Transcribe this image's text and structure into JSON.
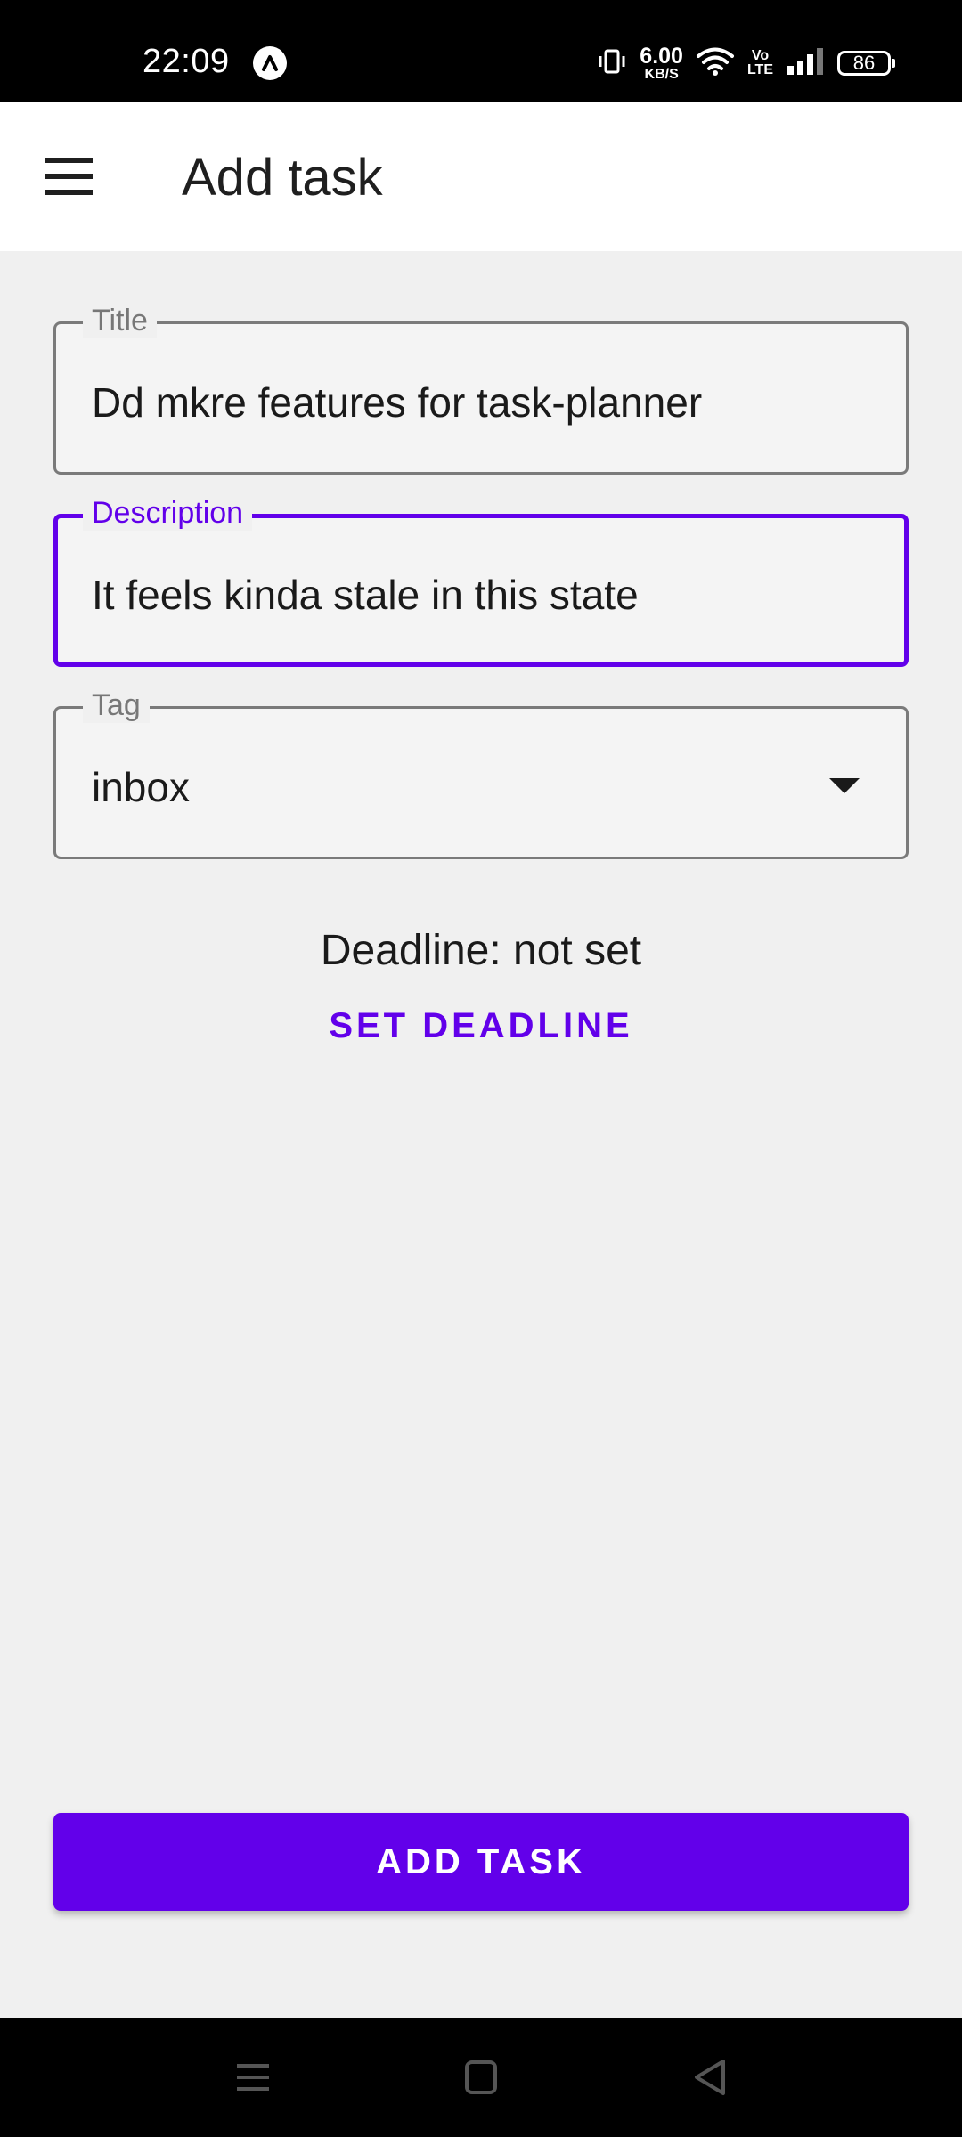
{
  "status_bar": {
    "time": "22:09",
    "net_speed_value": "6.00",
    "net_speed_unit": "KB/S",
    "volte_top": "Vo",
    "volte_bottom": "LTE",
    "battery": "86"
  },
  "app_bar": {
    "title": "Add task",
    "menu_icon": "hamburger-menu-icon"
  },
  "form": {
    "title_field": {
      "label": "Title",
      "value": "Dd mkre features for task-planner"
    },
    "description_field": {
      "label": "Description",
      "value": "It feels kinda stale in this state",
      "focused": true
    },
    "tag_field": {
      "label": "Tag",
      "value": "inbox",
      "icon": "dropdown-arrow-icon"
    },
    "deadline_text": "Deadline: not set",
    "set_deadline_label": "SET DEADLINE",
    "submit_label": "ADD TASK"
  },
  "colors": {
    "accent": "#6200ea",
    "background": "#f0f0f0",
    "app_bar": "#ffffff"
  },
  "nav_bar": {
    "icons": [
      "recent-apps-icon",
      "home-icon",
      "back-icon"
    ]
  }
}
